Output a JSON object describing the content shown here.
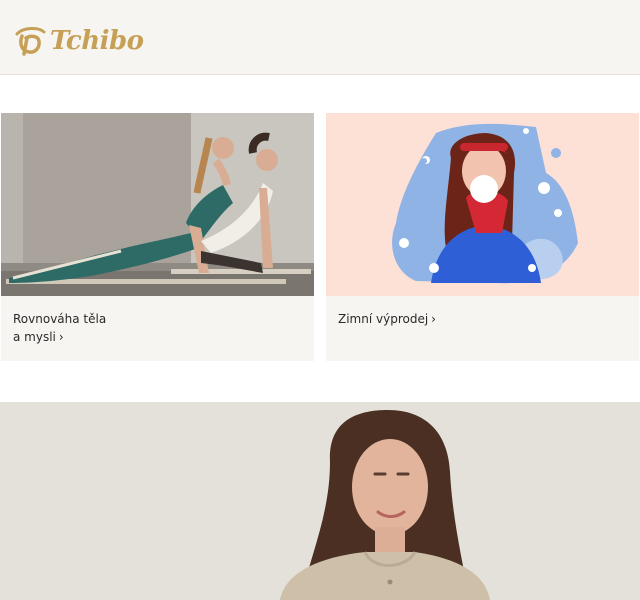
{
  "brand": {
    "name": "Tchibo",
    "logo_icon": "tchibo-cup-logo-icon",
    "color": "#c7a058"
  },
  "teasers": [
    {
      "line1": "Rovnováha těla",
      "line2": "a mysli",
      "chevron": "›"
    },
    {
      "line1": "Zimní výprodej",
      "chevron": "›"
    }
  ],
  "colors": {
    "header_bg": "#f7f5f1",
    "card_bg": "#f7f5f1",
    "winter_bg": "#fde1d6",
    "banner_bg": "#e4e0da"
  }
}
